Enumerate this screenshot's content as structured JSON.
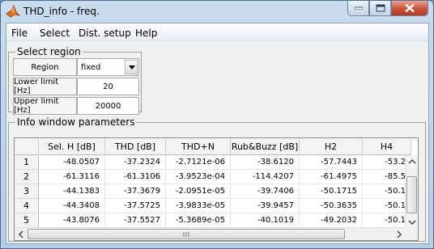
{
  "window": {
    "title": "THD_info - freq."
  },
  "menu": [
    "File",
    "Select",
    "Dist. setup",
    "Help"
  ],
  "select_region": {
    "legend": "Select region",
    "region_label": "Region",
    "region_value": "fixed",
    "lower_label": "Lower limit [Hz]",
    "lower_value": "20",
    "upper_label": "Upper limit [Hz]",
    "upper_value": "20000"
  },
  "info_panel": {
    "legend": "Info window parameters",
    "columns": [
      "Sel. H [dB]",
      "THD [dB]",
      "THD+N",
      "Rub&Buzz [dB]",
      "H2",
      "H4"
    ],
    "rows": [
      {
        "index": "1",
        "cells": [
          "-48.0507",
          "-37.2324",
          "-2.7121e-06",
          "-38.6120",
          "-57.7443",
          "-53.2"
        ]
      },
      {
        "index": "2",
        "cells": [
          "-61.3116",
          "-61.3106",
          "-3.9523e-04",
          "-114.4207",
          "-61.4975",
          "-85.5"
        ]
      },
      {
        "index": "3",
        "cells": [
          "-44.1383",
          "-37.3679",
          "-2.0951e-05",
          "-39.7406",
          "-50.1715",
          "-50.1"
        ]
      },
      {
        "index": "4",
        "cells": [
          "-44.3408",
          "-37.5725",
          "-3.9833e-05",
          "-39.9457",
          "-50.3635",
          "-50.1"
        ]
      },
      {
        "index": "5",
        "cells": [
          "-43.8076",
          "-37.5527",
          "-5.3689e-05",
          "-40.1019",
          "-49.2032",
          "-50.1"
        ]
      }
    ]
  }
}
